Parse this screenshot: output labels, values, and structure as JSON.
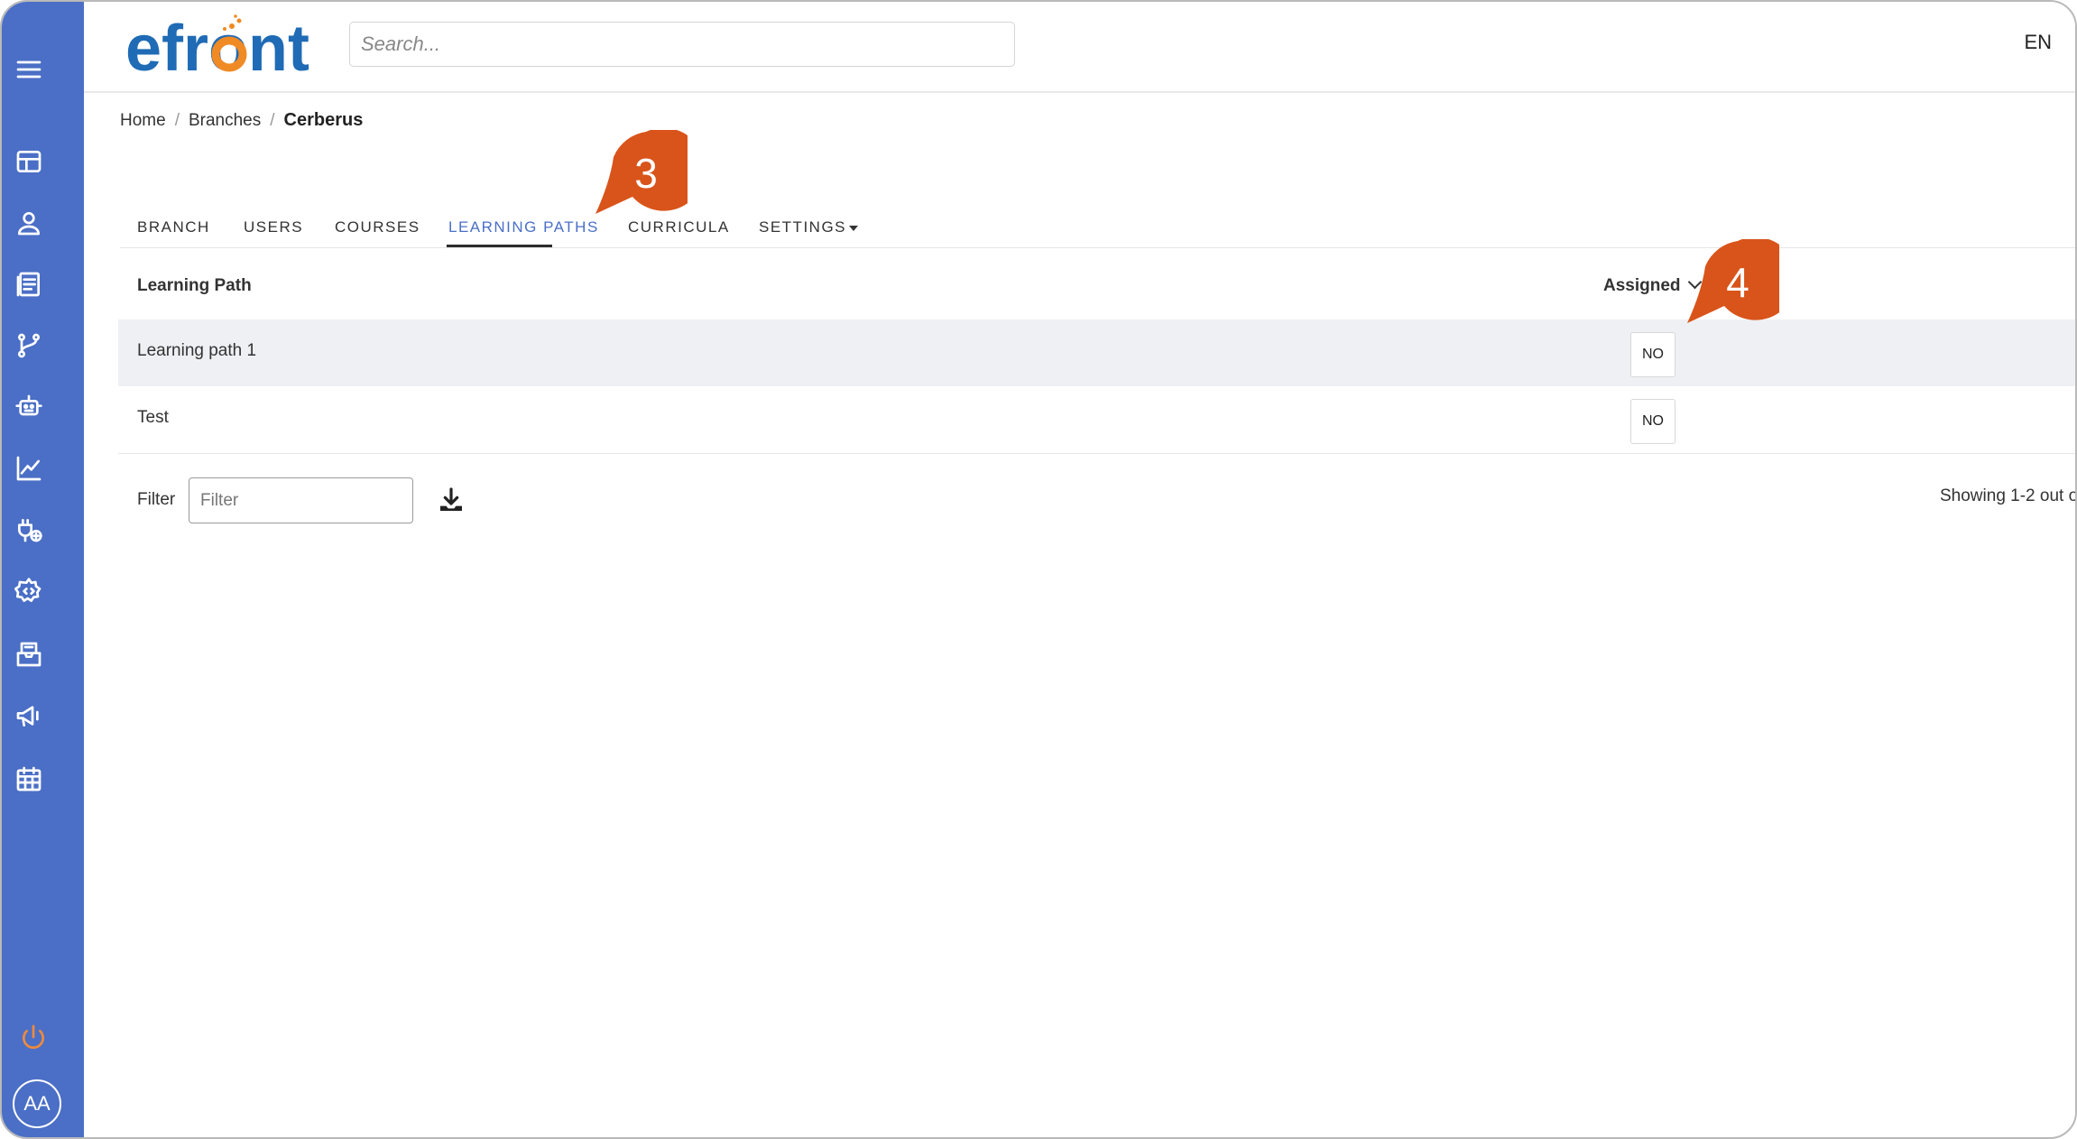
{
  "app": {
    "logo_text": "efront",
    "language": "EN",
    "avatar_initials": "AA"
  },
  "search": {
    "placeholder": "Search..."
  },
  "sidebar": {
    "items": [
      {
        "icon": "menu-icon"
      },
      {
        "icon": "dashboard-icon"
      },
      {
        "icon": "user-icon"
      },
      {
        "icon": "courses-icon"
      },
      {
        "icon": "branches-icon"
      },
      {
        "icon": "automation-icon"
      },
      {
        "icon": "reports-icon"
      },
      {
        "icon": "plugins-icon"
      },
      {
        "icon": "developer-settings-icon"
      },
      {
        "icon": "messages-icon"
      },
      {
        "icon": "announcements-icon"
      },
      {
        "icon": "calendar-icon"
      },
      {
        "icon": "power-icon"
      }
    ]
  },
  "breadcrumb": {
    "home": "Home",
    "branches": "Branches",
    "current": "Cerberus",
    "separator": "/"
  },
  "tabs": [
    {
      "label": "BRANCH",
      "active": false
    },
    {
      "label": "USERS",
      "active": false
    },
    {
      "label": "COURSES",
      "active": false
    },
    {
      "label": "LEARNING PATHS",
      "active": true
    },
    {
      "label": "CURRICULA",
      "active": false
    },
    {
      "label": "SETTINGS",
      "active": false
    }
  ],
  "table": {
    "columns": [
      "Learning Path",
      "Assigned"
    ],
    "rows": [
      {
        "name": "Learning path 1",
        "assigned": "NO"
      },
      {
        "name": "Test",
        "assigned": "NO"
      }
    ]
  },
  "footer": {
    "filter_label": "Filter",
    "filter_placeholder": "Filter",
    "showing": "Showing 1-2 out o"
  },
  "callouts": {
    "step_3": "3",
    "step_4": "4"
  },
  "colors": {
    "sidebar": "#4b6fc6",
    "accent": "#4b6fc6",
    "callout": "#d9541a",
    "logo_blue": "#1f6bb5",
    "logo_orange": "#f08a24"
  }
}
